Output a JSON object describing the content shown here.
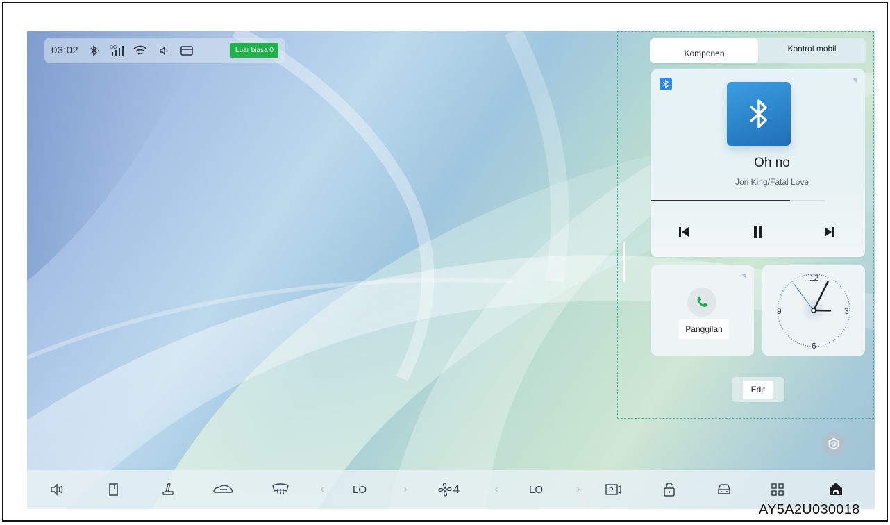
{
  "status_bar": {
    "time": "03:02",
    "icons": [
      "bluetooth-icon",
      "cellular-3g-icon",
      "wifi-icon",
      "volume-icon",
      "message-icon"
    ],
    "network_label": "3G",
    "alert_badge": "Luar biasa 0",
    "alert_color": "#1fb24a"
  },
  "widget_panel": {
    "tabs": [
      {
        "label": "Komponen",
        "active": true
      },
      {
        "label": "Kontrol mobil",
        "active": false
      }
    ],
    "media": {
      "source_icon": "bluetooth-icon",
      "title": "Oh no",
      "artist": "Jori King/Fatal Love",
      "progress": 0.8,
      "controls": [
        "previous-icon",
        "pause-icon",
        "next-icon"
      ]
    },
    "call": {
      "label": "Panggilan",
      "icon": "phone-icon"
    },
    "clock": {
      "numerals": [
        "12",
        "3",
        "6",
        "9"
      ],
      "hour": 3,
      "minute": 2
    },
    "edit_label": "Edit",
    "accent": "#36b7a9"
  },
  "dock": {
    "items": [
      {
        "icon": "volume-icon"
      },
      {
        "icon": "door-icon"
      },
      {
        "icon": "seat-icon"
      },
      {
        "icon": "car-mode-icon"
      },
      {
        "icon": "rear-defrost-icon"
      },
      {
        "icon": "chevron-left-icon"
      },
      {
        "label": "LO"
      },
      {
        "icon": "chevron-right-icon"
      },
      {
        "icon": "fan-icon",
        "label": "4"
      },
      {
        "icon": "chevron-left-icon"
      },
      {
        "label": "LO"
      },
      {
        "icon": "chevron-right-icon"
      },
      {
        "icon": "parking-camera-icon"
      },
      {
        "icon": "unlock-icon"
      },
      {
        "icon": "vehicle-icon"
      },
      {
        "icon": "app-grid-icon"
      },
      {
        "icon": "home-icon"
      }
    ],
    "left_temp": "LO",
    "right_temp": "LO",
    "fan_level": "4"
  },
  "doc_code": "AY5A2U030018"
}
